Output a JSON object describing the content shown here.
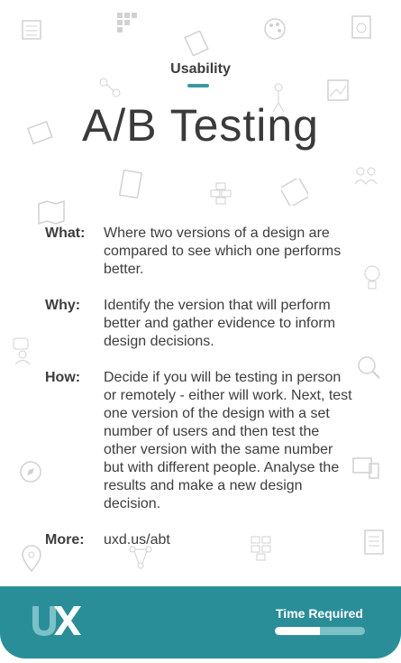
{
  "category": "Usability",
  "title": "A/B Testing",
  "sections": [
    {
      "label": "What:",
      "text": "Where two versions of a design are compared to see which one performs better."
    },
    {
      "label": "Why:",
      "text": "Identify the version that will perform better and gather evidence to inform design decisions."
    },
    {
      "label": "How:",
      "text": "Decide if you will be testing in person or remotely - either will work. Next, test one version of the design with a set number of users and then test the other version with the same number but with different people. Analyse the results and make a new design decision."
    },
    {
      "label": "More:",
      "text": "uxd.us/abt"
    }
  ],
  "footer": {
    "logo_text": "UX",
    "time_label": "Time Required",
    "time_level": 0.5
  },
  "colors": {
    "accent": "#2a8e99",
    "text": "#3d3d3d"
  }
}
